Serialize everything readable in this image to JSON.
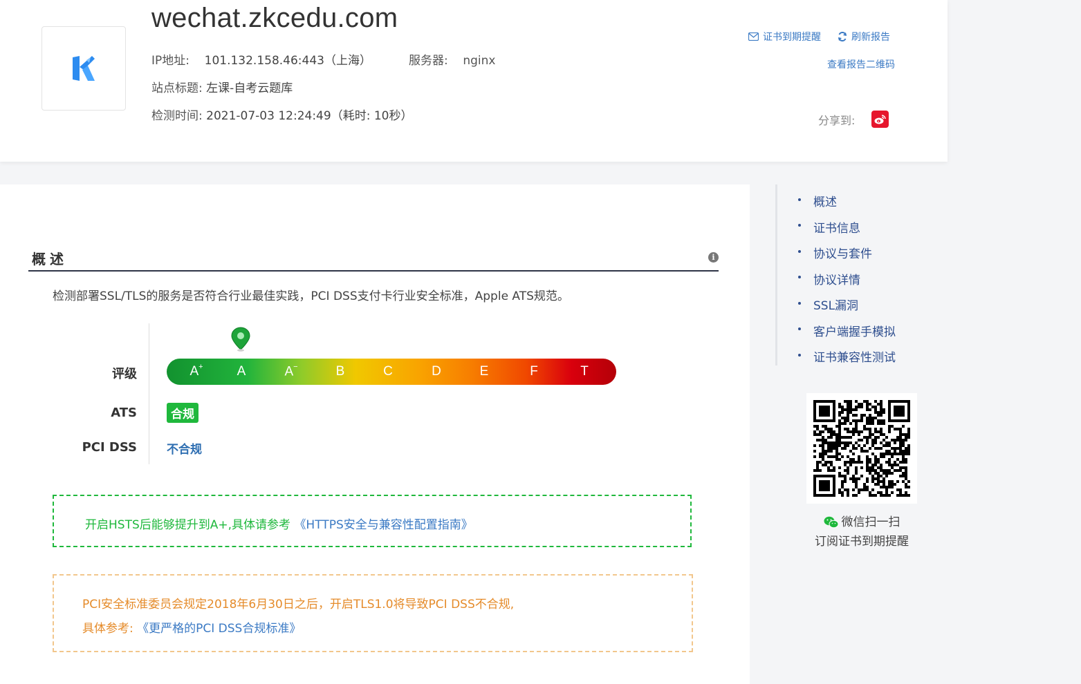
{
  "header": {
    "domain": "wechat.zkcedu.com",
    "ip_label": "IP地址:",
    "ip_value": "101.132.158.46:443（上海）",
    "server_label": "服务器:",
    "server_value": "nginx",
    "site_title_label": "站点标题:",
    "site_title_value": "左课-自考云题库",
    "check_time_label": "检测时间:",
    "check_time_value": "2021-07-03 12:24:49（耗时: 10秒）",
    "actions": {
      "cert_reminder": "证书到期提醒",
      "refresh_report": "刷新报告",
      "view_qr": "查看报告二维码"
    },
    "share_label": "分享到:"
  },
  "overview": {
    "title": "概述",
    "description": "检测部署SSL/TLS的服务是否符合行业最佳实践，PCI DSS支付卡行业安全标准，Apple ATS规范。",
    "grade_label": "评级",
    "grades": [
      "A+",
      "A",
      "A-",
      "B",
      "C",
      "D",
      "E",
      "F",
      "T"
    ],
    "current_grade": "A",
    "ats_label": "ATS",
    "ats_status": "合规",
    "pci_label": "PCI DSS",
    "pci_status": "不合规",
    "tip_green_text": "开启HSTS后能够提升到A+,具体请参考",
    "tip_green_link": "《HTTPS安全与兼容性配置指南》",
    "tip_orange_line1": "PCI安全标准委员会规定2018年6月30日之后，开启TLS1.0将导致PCI DSS不合规,",
    "tip_orange_prefix": "具体参考:",
    "tip_orange_link": "《更严格的PCI DSS合规标准》"
  },
  "sidebar": {
    "items": [
      {
        "label": "概述"
      },
      {
        "label": "证书信息"
      },
      {
        "label": "协议与套件"
      },
      {
        "label": "协议详情"
      },
      {
        "label": "SSL漏洞"
      },
      {
        "label": "客户端握手模拟"
      },
      {
        "label": "证书兼容性测试"
      }
    ],
    "qr_caption_line1": "微信扫一扫",
    "qr_caption_line2": "订阅证书到期提醒"
  },
  "colors": {
    "link": "#3b7ac4",
    "ok_green": "#1fb83c",
    "warn_orange": "#e58b2a",
    "nav_blue": "#2f4f8f"
  }
}
